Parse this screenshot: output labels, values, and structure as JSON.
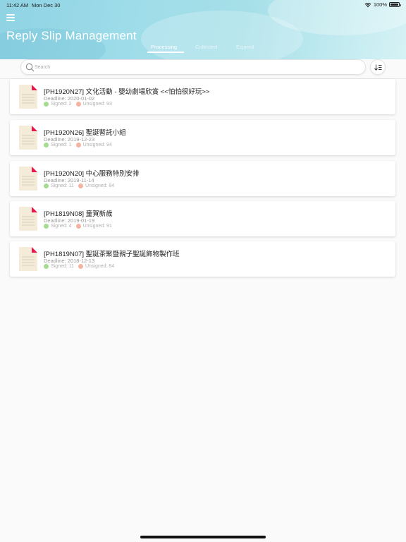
{
  "status_bar": {
    "time": "11:42 AM",
    "date": "Mon Dec 30",
    "battery": "100%"
  },
  "header": {
    "title": "Reply Slip Management",
    "tabs": [
      {
        "label": "Processing",
        "active": true
      },
      {
        "label": "Collected",
        "active": false
      },
      {
        "label": "Expired",
        "active": false
      }
    ]
  },
  "search": {
    "placeholder": "Search",
    "value": ""
  },
  "colors": {
    "signed": "#a4dd8f",
    "unsigned": "#f5b3a2",
    "doc_corner": "#e8174d"
  },
  "slips": [
    {
      "title": "[PH1920N27] 文化活動 - 嬰幼劇場欣賞 <<怕怕很好玩>>",
      "deadline": "Deadline: 2020-01-02",
      "signed": "Signed: 2",
      "unsigned": "Unsigned: 93"
    },
    {
      "title": "[PH1920N26] 聖誕暫託小組",
      "deadline": "Deadline: 2019-12-23",
      "signed": "Signed: 1",
      "unsigned": "Unsigned: 94"
    },
    {
      "title": "[PH1920N20] 中心服務特別安排",
      "deadline": "Deadline: 2019-11-14",
      "signed": "Signed: 11",
      "unsigned": "Unsigned: 84"
    },
    {
      "title": "[PH1819N08] 童賀新歲",
      "deadline": "Deadline: 2019-01-19",
      "signed": "Signed: 4",
      "unsigned": "Unsigned: 91"
    },
    {
      "title": "[PH1819N07] 聖誕茶聚暨親子聖誕飾物製作班",
      "deadline": "Deadline: 2018-12-13",
      "signed": "Signed: 11",
      "unsigned": "Unsigned: 84"
    }
  ]
}
